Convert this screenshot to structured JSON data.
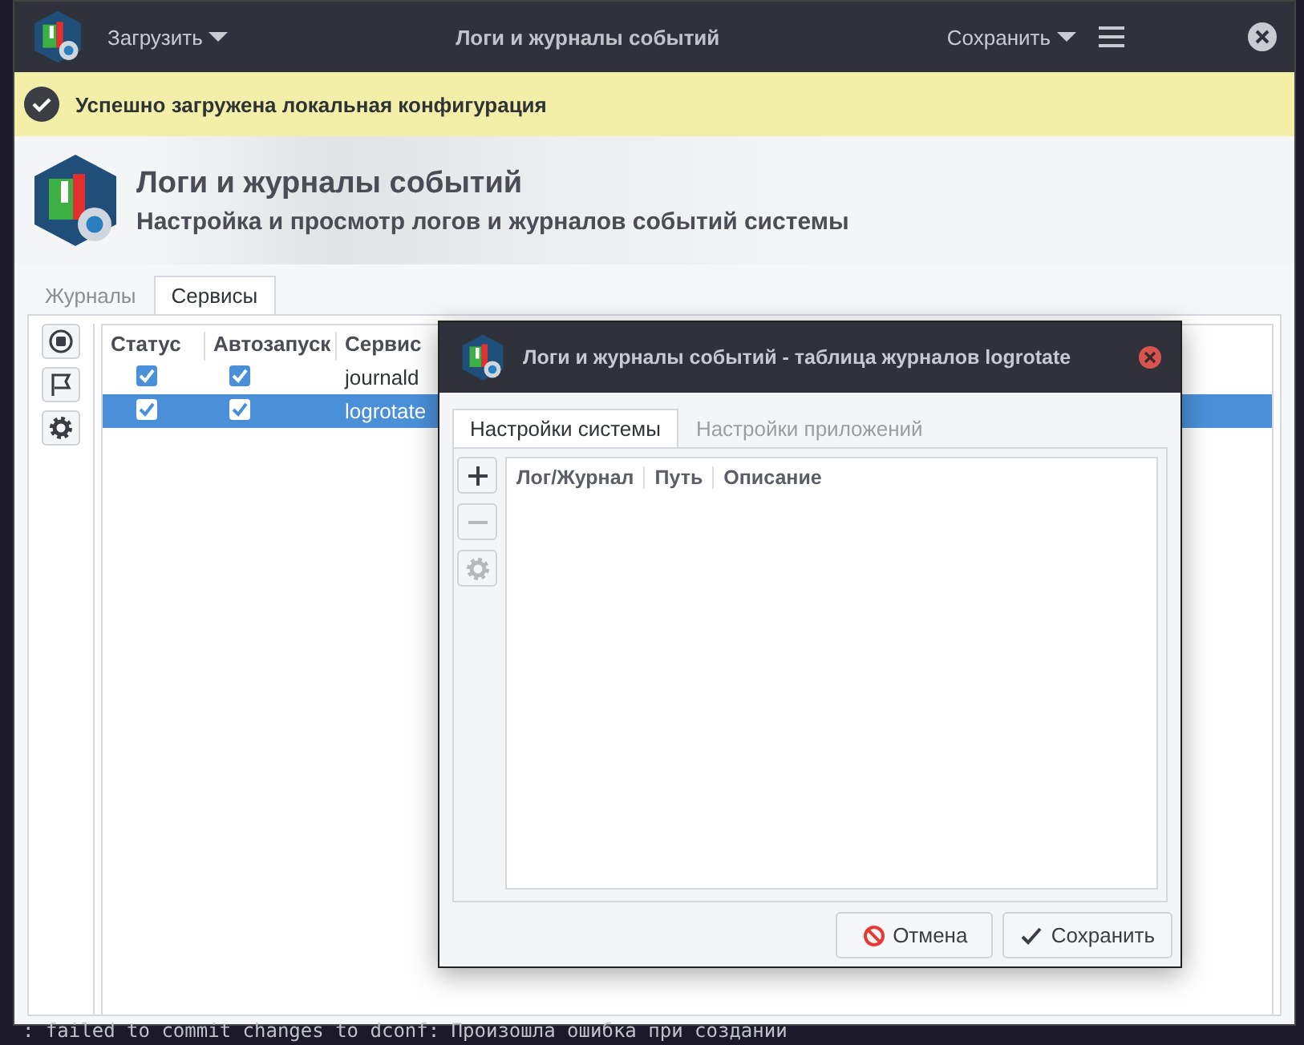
{
  "window": {
    "title": "Логи и журналы событий",
    "load_menu": "Загрузить",
    "save_menu": "Сохранить"
  },
  "infobar": {
    "message": "Успешно загружена локальная конфигурация"
  },
  "header": {
    "title": "Логи и журналы событий",
    "subtitle": "Настройка и просмотр логов и журналов событий системы"
  },
  "tabs": [
    {
      "label": "Журналы",
      "selected": false
    },
    {
      "label": "Сервисы",
      "selected": true
    }
  ],
  "services_tools": [
    {
      "kind": "stop"
    },
    {
      "kind": "flag"
    },
    {
      "kind": "settings"
    }
  ],
  "services_table": {
    "columns": [
      "Статус",
      "Автозапуск",
      "Сервис"
    ],
    "rows": [
      {
        "status": true,
        "autostart": true,
        "service": "journald",
        "selected": false
      },
      {
        "status": true,
        "autostart": true,
        "service": "logrotate",
        "selected": true
      }
    ]
  },
  "dialog": {
    "title": "Логи и журналы событий - таблица журналов logrotate",
    "tabs": [
      {
        "label": "Настройки системы",
        "selected": true
      },
      {
        "label": "Настройки приложений",
        "selected": false
      }
    ],
    "tools": [
      {
        "kind": "add",
        "disabled": false
      },
      {
        "kind": "remove",
        "disabled": true
      },
      {
        "kind": "settings",
        "disabled": true
      }
    ],
    "table": {
      "columns": [
        "Лог/Журнал",
        "Путь",
        "Описание"
      ]
    },
    "buttons": [
      {
        "label": "Отмена",
        "kind": "cancel"
      },
      {
        "label": "Сохранить",
        "kind": "save"
      }
    ]
  },
  "terminal_line": ": failed to commit changes to dconf: Произошла ошибка при создании"
}
